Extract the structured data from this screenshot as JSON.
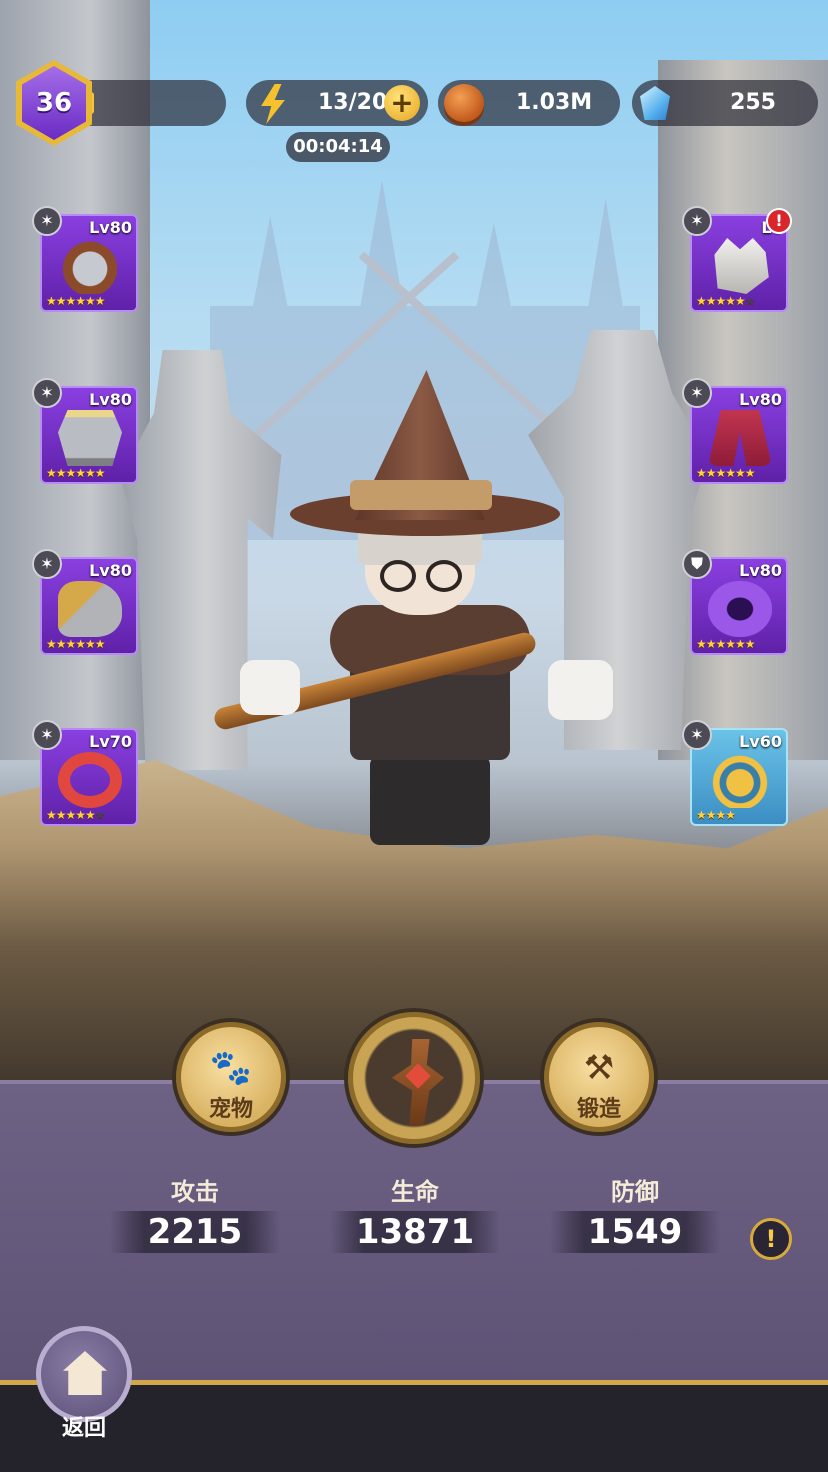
{
  "player": {
    "level": "36",
    "exp_fraction": 0.08
  },
  "resources": {
    "energy": "13/20",
    "energy_timer": "00:04:14",
    "coins": "1.03M",
    "gems": "255"
  },
  "equipment_left": [
    {
      "slot": "helmet",
      "level": "Lv80",
      "stars": 6,
      "max_stars": 6,
      "icon": "helmet-icon"
    },
    {
      "slot": "armor",
      "level": "Lv80",
      "stars": 6,
      "max_stars": 6,
      "icon": "armor-icon"
    },
    {
      "slot": "gauntlet",
      "level": "Lv80",
      "stars": 6,
      "max_stars": 6,
      "icon": "gauntlet-icon"
    },
    {
      "slot": "ring",
      "level": "Lv70",
      "stars": 5,
      "max_stars": 6,
      "icon": "ring-icon"
    }
  ],
  "equipment_right": [
    {
      "slot": "gloves",
      "level": "Lv",
      "stars": 5,
      "max_stars": 6,
      "icon": "glove-icon",
      "alert": "!"
    },
    {
      "slot": "cape",
      "level": "Lv80",
      "stars": 6,
      "max_stars": 6,
      "icon": "cape-icon"
    },
    {
      "slot": "bracer",
      "level": "Lv80",
      "stars": 6,
      "max_stars": 6,
      "icon": "bracer-icon"
    },
    {
      "slot": "amulet",
      "level": "Lv60",
      "stars": 4,
      "max_stars": 4,
      "icon": "amulet-icon"
    }
  ],
  "actions": {
    "pet_label": "宠物",
    "forge_label": "锻造"
  },
  "stats": {
    "attack_label": "攻击",
    "attack_value": "2215",
    "hp_label": "生命",
    "hp_value": "13871",
    "defense_label": "防御",
    "defense_value": "1549"
  },
  "info_symbol": "!",
  "nav": {
    "back_label": "返回"
  },
  "colors": {
    "epic_purple": "#7a34d2",
    "legendary_teal": "#5ab3e0",
    "gold": "#d6ab3b",
    "panel": "#6b5f82"
  }
}
